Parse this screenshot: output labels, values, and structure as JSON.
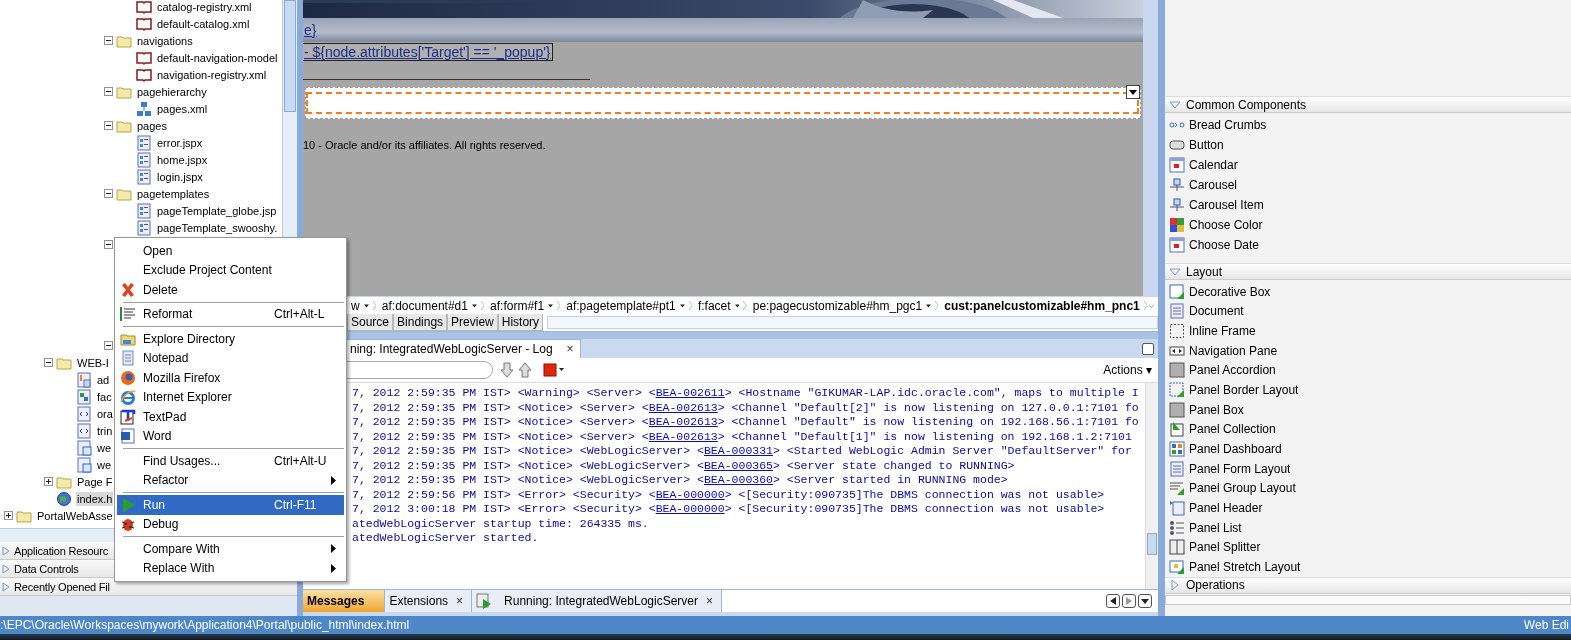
{
  "tree": {
    "top": [
      {
        "children": [
          {
            "children": [
              {
                "children": [
                  {
                    "children": [
                      {
                        "children": [
                          {
                            "children": [
                              {
                                "label": "catalog-registry.xml",
                                "kind": "catalog",
                                "selected": false
                              },
                              {
                                "label": "default-catalog.xml",
                                "kind": "catalog",
                                "selected": false
                              }
                            ]
                          },
                          {
                            "label": "navigations",
                            "kind": "folder",
                            "expanded": true,
                            "selected": false,
                            "children": [
                              {
                                "label": "default-navigation-model",
                                "kind": "catalog",
                                "selected": false
                              },
                              {
                                "label": "navigation-registry.xml",
                                "kind": "catalog",
                                "selected": false
                              }
                            ]
                          },
                          {
                            "label": "pagehierarchy",
                            "kind": "folder",
                            "expanded": true,
                            "selected": false,
                            "children": [
                              {
                                "label": "pages.xml",
                                "kind": "sitemap",
                                "selected": false
                              }
                            ]
                          },
                          {
                            "label": "pages",
                            "kind": "folder",
                            "expanded": true,
                            "selected": false,
                            "children": [
                              {
                                "label": "error.jspx",
                                "kind": "page",
                                "selected": false
                              },
                              {
                                "label": "home.jspx",
                                "kind": "page",
                                "selected": false
                              },
                              {
                                "label": "login.jspx",
                                "kind": "page",
                                "selected": false
                              }
                            ]
                          },
                          {
                            "label": "pagetemplates",
                            "kind": "folder",
                            "expanded": true,
                            "selected": false,
                            "children": [
                              {
                                "label": "pageTemplate_globe.jsp",
                                "kind": "page",
                                "selected": false
                              },
                              {
                                "label": "pageTemplate_swooshy.",
                                "kind": "page",
                                "selected": false
                              }
                            ]
                          },
                          {
                            "expanded": true
                          }
                        ]
                      }
                    ]
                  }
                ]
              }
            ]
          }
        ]
      }
    ],
    "bottom": [
      {
        "children": [
          {
            "children": [
              {
                "children": [
                  {
                    "children": [
                      {
                        "children": [
                          {
                            "expanded": true
                          }
                        ]
                      }
                    ]
                  }
                ]
              },
              {
                "label": "WEB-I",
                "kind": "folder",
                "expanded": true,
                "selected": false,
                "children": [
                  {
                    "label": "ad",
                    "kind": "config",
                    "selected": false
                  },
                  {
                    "label": "fac",
                    "kind": "faces",
                    "selected": false
                  },
                  {
                    "label": "ora",
                    "kind": "xmlfile",
                    "selected": false
                  },
                  {
                    "label": "trin",
                    "kind": "xmlfile",
                    "selected": false
                  },
                  {
                    "label": "we",
                    "kind": "webxml",
                    "selected": false
                  },
                  {
                    "label": "we",
                    "kind": "webxml",
                    "selected": false
                  }
                ]
              },
              {
                "label": "Page F",
                "kind": "folder",
                "expanded": false,
                "selected": false
              },
              {
                "label": "index.h",
                "kind": "html",
                "selected": true
              }
            ]
          }
        ]
      },
      {
        "label": "PortalWebAsse",
        "kind": "project",
        "expanded": false,
        "selected": false
      }
    ]
  },
  "accordions": [
    {
      "label": "Application Resourc",
      "expanded": false
    },
    {
      "label": "Data Controls",
      "expanded": false
    },
    {
      "label": "Recently Opened Fil",
      "expanded": false
    }
  ],
  "design": {
    "heading_link": "e}",
    "expression": "- ${node.attributes['Target'] == '_popup'}",
    "copyright": "10 - Oracle and/or its affiliates. All rights reserved."
  },
  "breadcrumbs": [
    {
      "label": "w",
      "selected": false
    },
    {
      "label": "af:document#d1",
      "selected": false
    },
    {
      "label": "af:form#f1",
      "selected": false
    },
    {
      "label": "af:pagetemplate#pt1",
      "selected": false
    },
    {
      "label": "f:facet",
      "selected": false
    },
    {
      "label": "pe:pagecustomizable#hm_pgc1",
      "selected": false
    },
    {
      "label": "cust:panelcustomizable#hm_pnc1",
      "selected": true
    }
  ],
  "editor_tabs": [
    {
      "label": "Source",
      "selected": false
    },
    {
      "label": "Bindings",
      "selected": false
    },
    {
      "label": "Preview",
      "selected": false
    },
    {
      "label": "History",
      "selected": false
    }
  ],
  "log": {
    "tab": "ning: IntegratedWebLogicServer - Log",
    "close": "×",
    "actions": "Actions ▾",
    "lines": [
      {
        "pre": "7, 2012 2:59:35 PM IST> <Warning> <Server> <",
        "link": "BEA-002611",
        "post": "> <Hostname \"GIKUMAR-LAP.idc.oracle.com\", maps to multiple I"
      },
      {
        "pre": "7, 2012 2:59:35 PM IST> <Notice> <Server> <",
        "link": "BEA-002613",
        "post": "> <Channel \"Default[2]\" is now listening on 127.0.0.1:7101 fo"
      },
      {
        "pre": "7, 2012 2:59:35 PM IST> <Notice> <Server> <",
        "link": "BEA-002613",
        "post": "> <Channel \"Default\" is now listening on 192.168.56.1:7101 fo"
      },
      {
        "pre": "7, 2012 2:59:35 PM IST> <Notice> <Server> <",
        "link": "BEA-002613",
        "post": "> <Channel \"Default[1]\" is now listening on 192.168.1.2:7101"
      },
      {
        "pre": "7, 2012 2:59:35 PM IST> <Notice> <WebLogicServer> <",
        "link": "BEA-000331",
        "post": "> <Started WebLogic Admin Server \"DefaultServer\" for"
      },
      {
        "pre": "7, 2012 2:59:35 PM IST> <Notice> <WebLogicServer> <",
        "link": "BEA-000365",
        "post": "> <Server state changed to RUNNING>"
      },
      {
        "pre": "7, 2012 2:59:35 PM IST> <Notice> <WebLogicServer> <",
        "link": "BEA-000360",
        "post": "> <Server started in RUNNING mode>"
      },
      {
        "pre": "7, 2012 2:59:56 PM IST> <Error> <Security> <",
        "link": "BEA-000000",
        "post": "> <[Security:090735]The DBMS connection was not usable>"
      },
      {
        "pre": "7, 2012 3:00:18 PM IST> <Error> <Security> <",
        "link": "BEA-000000",
        "post": "> <[Security:090735]The DBMS connection was not usable>"
      },
      {
        "pre": "atedWebLogicServer startup time: 264335 ms."
      },
      {
        "pre": "atedWebLogicServer started."
      }
    ]
  },
  "bottom_tabs": [
    {
      "label": "Messages",
      "selected": true,
      "close": false
    },
    {
      "label": "Extensions",
      "selected": false,
      "close": true
    },
    {
      "label": "Running: IntegratedWebLogicServer",
      "selected": false,
      "close": true,
      "running": true
    }
  ],
  "palette": [
    {
      "label": "Common Components",
      "expanded": true,
      "items": [
        {
          "label": "Bread Crumbs",
          "kind": "crumbs"
        },
        {
          "label": "Button",
          "kind": "button"
        },
        {
          "label": "Calendar",
          "kind": "calendar"
        },
        {
          "label": "Carousel",
          "kind": "carousel"
        },
        {
          "label": "Carousel Item",
          "kind": "carousel"
        },
        {
          "label": "Choose Color",
          "kind": "color"
        },
        {
          "label": "Choose Date",
          "kind": "calendar"
        }
      ]
    },
    {
      "label": "Layout",
      "expanded": true,
      "items": [
        {
          "label": "Decorative Box",
          "kind": "greenbox"
        },
        {
          "label": "Document",
          "kind": "document"
        },
        {
          "label": "Inline Frame",
          "kind": "frame"
        },
        {
          "label": "Navigation Pane",
          "kind": "nav"
        },
        {
          "label": "Panel Accordion",
          "kind": "panel"
        },
        {
          "label": "Panel Border Layout",
          "kind": "greenframe"
        },
        {
          "label": "Panel Box",
          "kind": "panel"
        },
        {
          "label": "Panel Collection",
          "kind": "collection"
        },
        {
          "label": "Panel Dashboard",
          "kind": "dashboard"
        },
        {
          "label": "Panel Form Layout",
          "kind": "form"
        },
        {
          "label": "Panel Group Layout",
          "kind": "group"
        },
        {
          "label": "Panel Header",
          "kind": "header"
        },
        {
          "label": "Panel List",
          "kind": "list"
        },
        {
          "label": "Panel Splitter",
          "kind": "splitter"
        },
        {
          "label": "Panel Stretch Layout",
          "kind": "stretch"
        }
      ]
    },
    {
      "label": "Operations",
      "expanded": false
    }
  ],
  "menu": [
    {
      "kind": "plain",
      "label": "Open",
      "selected": false
    },
    {
      "kind": "plain",
      "label": "Exclude Project Content",
      "selected": false
    },
    {
      "kind": "delete",
      "label": "Delete",
      "selected": false
    },
    {
      "kind": "separator"
    },
    {
      "kind": "reformat",
      "label": "Reformat",
      "shortcut": "Ctrl+Alt-L",
      "selected": false
    },
    {
      "kind": "separator"
    },
    {
      "kind": "explorer",
      "label": "Explore Directory",
      "selected": false
    },
    {
      "kind": "notepad",
      "label": "Notepad",
      "selected": false
    },
    {
      "kind": "firefox",
      "label": "Mozilla Firefox",
      "selected": false
    },
    {
      "kind": "ie",
      "label": "Internet Explorer",
      "selected": false
    },
    {
      "kind": "textpad",
      "label": "TextPad",
      "selected": false
    },
    {
      "kind": "word",
      "label": "Word",
      "selected": false
    },
    {
      "kind": "separator"
    },
    {
      "kind": "plain",
      "label": "Find Usages...",
      "shortcut": "Ctrl+Alt-U",
      "selected": false
    },
    {
      "kind": "plain",
      "label": "Refactor",
      "submenu": true,
      "selected": false
    },
    {
      "kind": "separator"
    },
    {
      "kind": "run",
      "label": "Run",
      "shortcut": "Ctrl-F11",
      "selected": true
    },
    {
      "kind": "debug",
      "label": "Debug",
      "selected": false
    },
    {
      "kind": "separator"
    },
    {
      "kind": "plain",
      "label": "Compare With",
      "submenu": true,
      "selected": false
    },
    {
      "kind": "plain",
      "label": "Replace With",
      "submenu": true,
      "selected": false
    }
  ],
  "status_bar": {
    "path": ":\\EPC\\Oracle\\Workspaces\\mywork\\Application4\\Portal\\public_html\\index.html",
    "right": "Web Edi"
  }
}
